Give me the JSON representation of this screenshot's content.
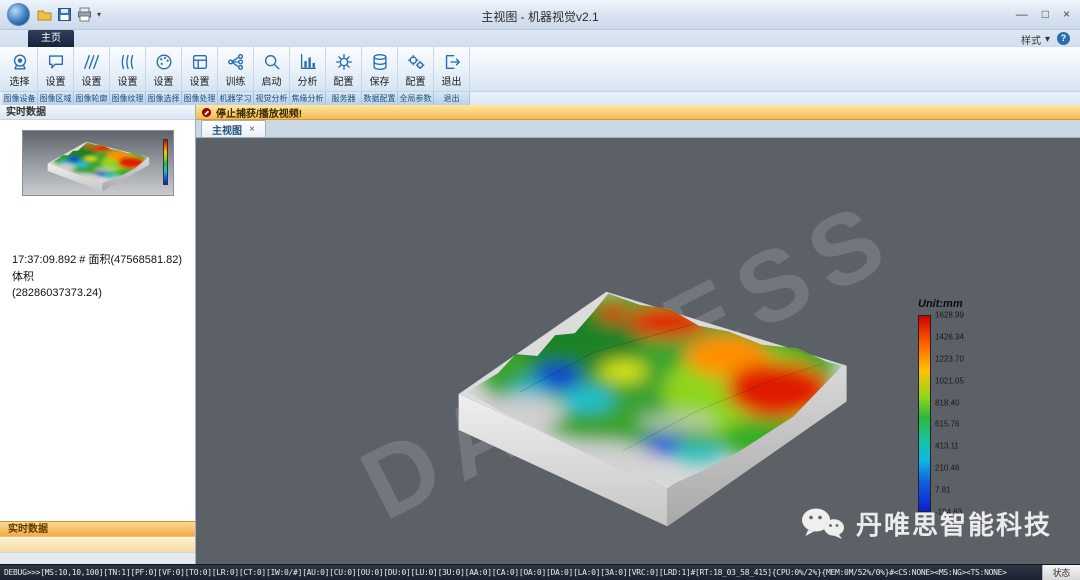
{
  "window": {
    "title": "主视图 - 机器视觉v2.1",
    "minimize": "—",
    "maximize": "□",
    "close": "×"
  },
  "ribbon": {
    "home_tab": "主页",
    "style_menu": "样式",
    "style_caret": "▾",
    "help": "?",
    "groups": [
      {
        "button": "选择",
        "icon": "webcam",
        "group": "图像设备"
      },
      {
        "button": "设置",
        "icon": "bubble",
        "group": "图像区域"
      },
      {
        "button": "设置",
        "icon": "slashes",
        "group": "图像轮廓"
      },
      {
        "button": "设置",
        "icon": "waves",
        "group": "图像纹理"
      },
      {
        "button": "设置",
        "icon": "palette",
        "group": "图像选择"
      },
      {
        "button": "设置",
        "icon": "process",
        "group": "图像处理"
      },
      {
        "button": "训练",
        "icon": "network",
        "group": "机器学习"
      },
      {
        "button": "启动",
        "icon": "launch",
        "group": "视觉分析"
      },
      {
        "button": "分析",
        "icon": "chart",
        "group": "焦缘分析"
      },
      {
        "button": "配置",
        "icon": "gear",
        "group": "服务器"
      },
      {
        "button": "保存",
        "icon": "database",
        "group": "数据配置"
      },
      {
        "button": "配置",
        "icon": "gears",
        "group": "全局参数"
      },
      {
        "button": "退出",
        "icon": "exit",
        "group": "退出"
      }
    ]
  },
  "left_panel": {
    "header": "实时数据",
    "data_line1": "17:37:09.892 # 面积(47568581.82) 体积",
    "data_line2": "(28286037373.24)",
    "bottom_tab": "实时数据"
  },
  "main": {
    "alert_text": "停止捕获/播放视频!",
    "doc_tab": "主视图",
    "doc_tab_close": "×",
    "watermark": "DANVESS",
    "brand_text": "丹唯思智能科技"
  },
  "colorbar": {
    "title": "Unit:mm",
    "ticks": [
      "1628.99",
      "1426.34",
      "1223.70",
      "1021.05",
      "818.40",
      "615.76",
      "413.11",
      "210.46",
      "7.81",
      "-194.83"
    ]
  },
  "statusbar": {
    "text": "DEBUG>>>[MS:10,10,100][TN:1][PF:0][VF:0][TO:0][LR:0][CT:0][IW:0/#][AU:0][CU:0][OU:0][DU:0][LU:0][3U:0][AA:0][CA:0][OA:0][DA:0][LA:0][3A:0][VRC:0][LRD:1]#[RT:18_03_58_415]{CPU:0%/2%}{MEM:0M/52%/0%}#<CS:NONE><MS:NG><TS:NONE>",
    "right_label": "状态"
  },
  "colors": {
    "accent_blue": "#2b6cb0",
    "alert_bg": "#f6bb54",
    "viewport_bg": "#5c6167"
  }
}
